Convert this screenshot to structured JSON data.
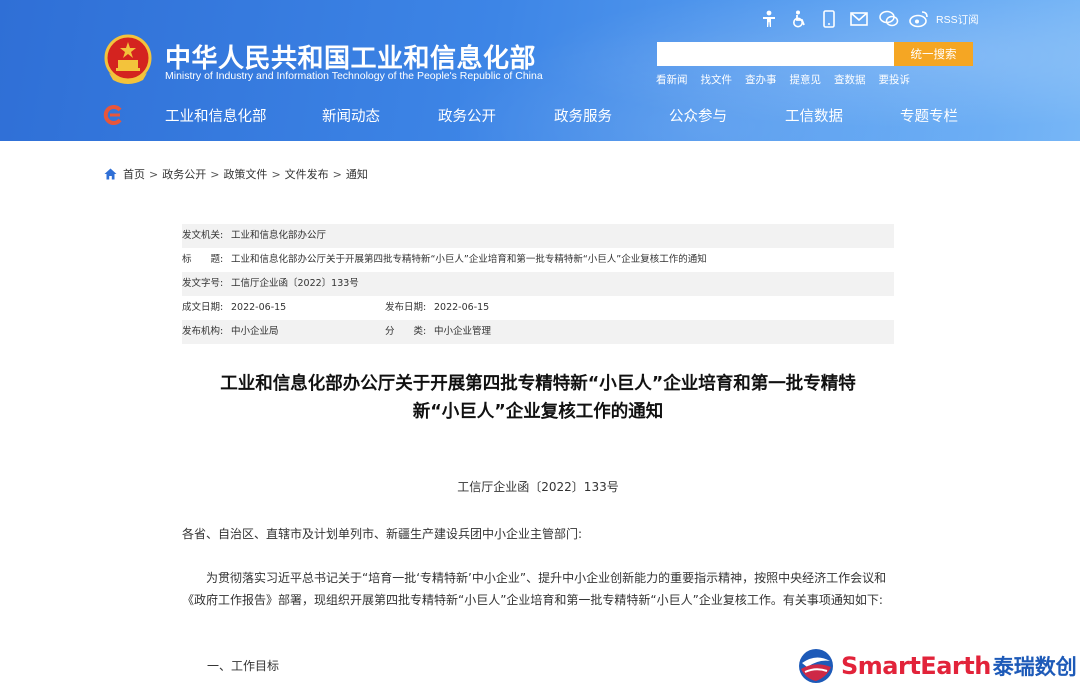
{
  "header": {
    "site_title": "中华人民共和国工业和信息化部",
    "site_subtitle": "Ministry of Industry and Information Technology of the People's Republic of China",
    "tool_icons": [
      "accessibility-person-icon",
      "wheelchair-icon",
      "mobile-phone-icon",
      "mail-icon",
      "wechat-icon",
      "weibo-icon"
    ],
    "rss_label": "RSS订阅",
    "search": {
      "value": "",
      "placeholder": "",
      "button_label": "统一搜索"
    },
    "quick_links": [
      "看新闻",
      "找文件",
      "查办事",
      "提意见",
      "查数据",
      "要投诉"
    ],
    "nav": [
      "工业和信息化部",
      "新闻动态",
      "政务公开",
      "政务服务",
      "公众参与",
      "工信数据",
      "专题专栏"
    ],
    "colors": {
      "header_blue": "#3d85e6",
      "search_button": "#f5a623",
      "nav_logo": "#e8563a"
    }
  },
  "breadcrumb": {
    "items": [
      "首页",
      "政务公开",
      "政策文件",
      "文件发布",
      "通知"
    ],
    "separator": ">"
  },
  "meta": {
    "issuer_label": "发文机关:",
    "issuer": "工业和信息化部办公厅",
    "title_label": "标　　题:",
    "title": "工业和信息化部办公厅关于开展第四批专精特新“小巨人”企业培育和第一批专精特新“小巨人”企业复核工作的通知",
    "doc_no_label": "发文字号:",
    "doc_no": "工信厅企业函〔2022〕133号",
    "created_label": "成文日期:",
    "created": "2022-06-15",
    "published_label": "发布日期:",
    "published": "2022-06-15",
    "org_label": "发布机构:",
    "org": "中小企业局",
    "category_label": "分　　类:",
    "category": "中小企业管理"
  },
  "article": {
    "title_line1": "工业和信息化部办公厅关于开展第四批专精特新“小巨人”企业培育和第一批专精特",
    "title_line2": "新“小巨人”企业复核工作的通知",
    "doc_number": "工信厅企业函〔2022〕133号",
    "salutation": "各省、自治区、直辖市及计划单列市、新疆生产建设兵团中小企业主管部门:",
    "body_para1": "为贯彻落实习近平总书记关于“培育一批‘专精特新’中小企业”、提升中小企业创新能力的重要指示精神，按照中央经济工作会议和《政府工作报告》部署，现组织开展第四批专精特新“小巨人”企业培育和第一批专精特新“小巨人”企业复核工作。有关事项通知如下:",
    "section1": "一、工作目标"
  },
  "watermark": {
    "brand_en": "SmartEarth",
    "brand_cn": "泰瑞数创"
  }
}
